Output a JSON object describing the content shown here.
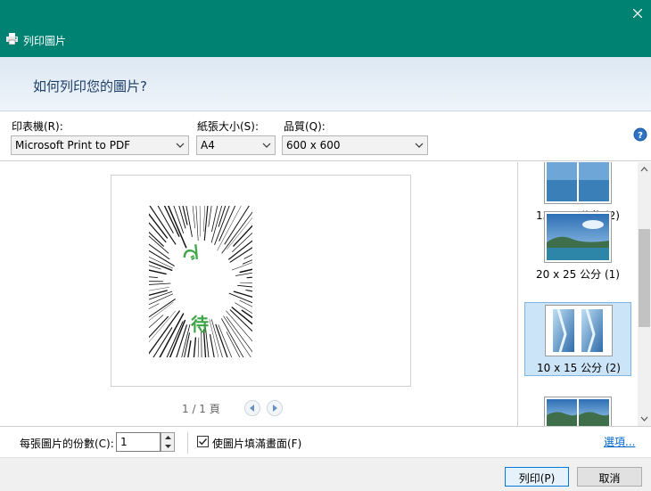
{
  "window": {
    "title": "列印圖片",
    "close_glyph": "✕"
  },
  "header": {
    "question": "如何列印您的圖片?"
  },
  "printer": {
    "label": "印表機(R):",
    "value": "Microsoft Print to PDF"
  },
  "paper_size": {
    "label": "紙張大小(S):",
    "value": "A4"
  },
  "quality": {
    "label": "品質(Q):",
    "value": "600 x 600"
  },
  "help": {
    "glyph": "?"
  },
  "preview": {
    "page_indicator": "1 / 1 頁",
    "artwork_text": [
      "で",
      "待"
    ],
    "artwork_text_color": "#3fa648"
  },
  "layouts": {
    "items": [
      {
        "label": "13 x 18 公分 (2)"
      },
      {
        "label": "20 x 25 公分 (1)"
      },
      {
        "label": "10 x 15 公分 (2)",
        "selected": true
      },
      {
        "label": ""
      }
    ]
  },
  "bottom": {
    "copies_label": "每張圖片的份數(C):",
    "copies_value": "1",
    "fit_label": "使圖片填滿畫面(F)",
    "fit_checked": true,
    "options_link": "選項..."
  },
  "footer": {
    "print_button": "列印(P)",
    "cancel_button": "取消"
  },
  "colors": {
    "titlebar": "#008272",
    "selection": "#cce4f7",
    "link": "#0066cc"
  }
}
